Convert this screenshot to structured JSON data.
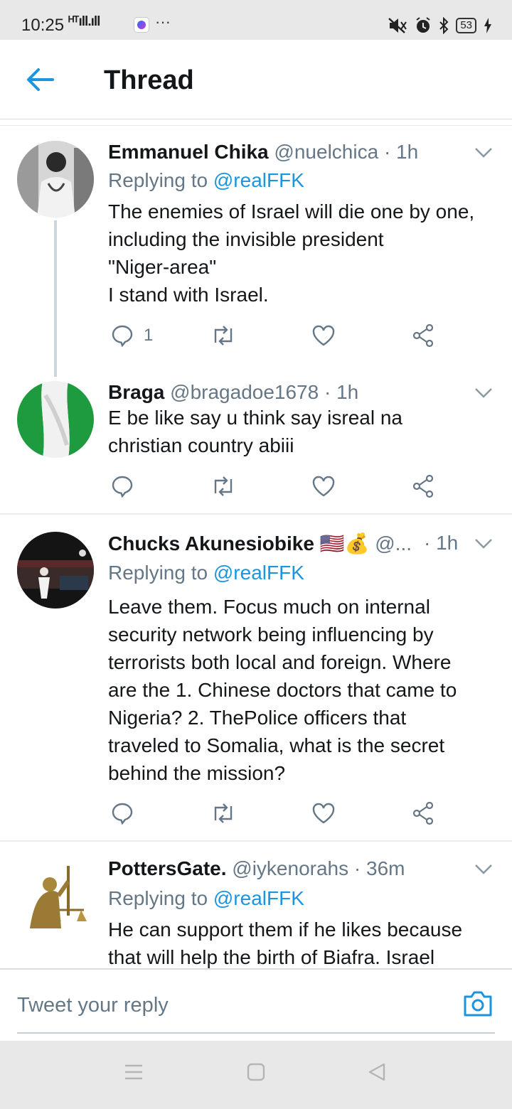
{
  "status_bar": {
    "time": "10:25",
    "signal": "ᴴᵀıll.ıll",
    "dots": "···",
    "battery": "53",
    "icons": [
      "messenger-icon",
      "mute-icon",
      "alarm-icon",
      "bluetooth-icon",
      "charging-icon"
    ]
  },
  "header": {
    "title": "Thread",
    "back_icon": "back-arrow-icon"
  },
  "tweets": [
    {
      "name": "Emmanuel Chika",
      "handle": "@nuelchica",
      "time": "· 1h",
      "replying_prefix": "Replying to",
      "replying_to": "@realFFK",
      "lines": [
        "The enemies of Israel will die one by one,",
        "including the invisible president",
        "\"Niger-area\"",
        "I stand with Israel."
      ],
      "reply_count": "1"
    },
    {
      "name": "Braga",
      "handle": "@bragadoe1678",
      "time": "· 1h",
      "lines": [
        "E be like say u think say isreal na",
        "christian country abiii"
      ],
      "reply_count": ""
    },
    {
      "name": "Chucks Akunesiobike",
      "flags": "🇺🇸💰",
      "handle": "@...",
      "time": "· 1h",
      "replying_prefix": "Replying to",
      "replying_to": "@realFFK",
      "lines": [
        "Leave them. Focus much on internal",
        "security network being influencing by",
        "terrorists both local and foreign. Where",
        "are the 1. Chinese doctors that came to",
        "Nigeria? 2. ThePolice officers that",
        "traveled to Somalia, what is the secret",
        "behind the mission?"
      ],
      "reply_count": ""
    },
    {
      "name": "PottersGate.",
      "handle": "@iykenorahs",
      "time": "· 36m",
      "replying_prefix": "Replying to",
      "replying_to": "@realFFK",
      "lines": [
        "He can support them if he likes because",
        "that will help the birth of Biafra. Israel"
      ]
    }
  ],
  "compose": {
    "placeholder": "Tweet your reply"
  },
  "colors": {
    "accent": "#1b95e0",
    "secondary_text": "#657786",
    "primary_text": "#14171a",
    "separator": "#e6ecf0"
  }
}
